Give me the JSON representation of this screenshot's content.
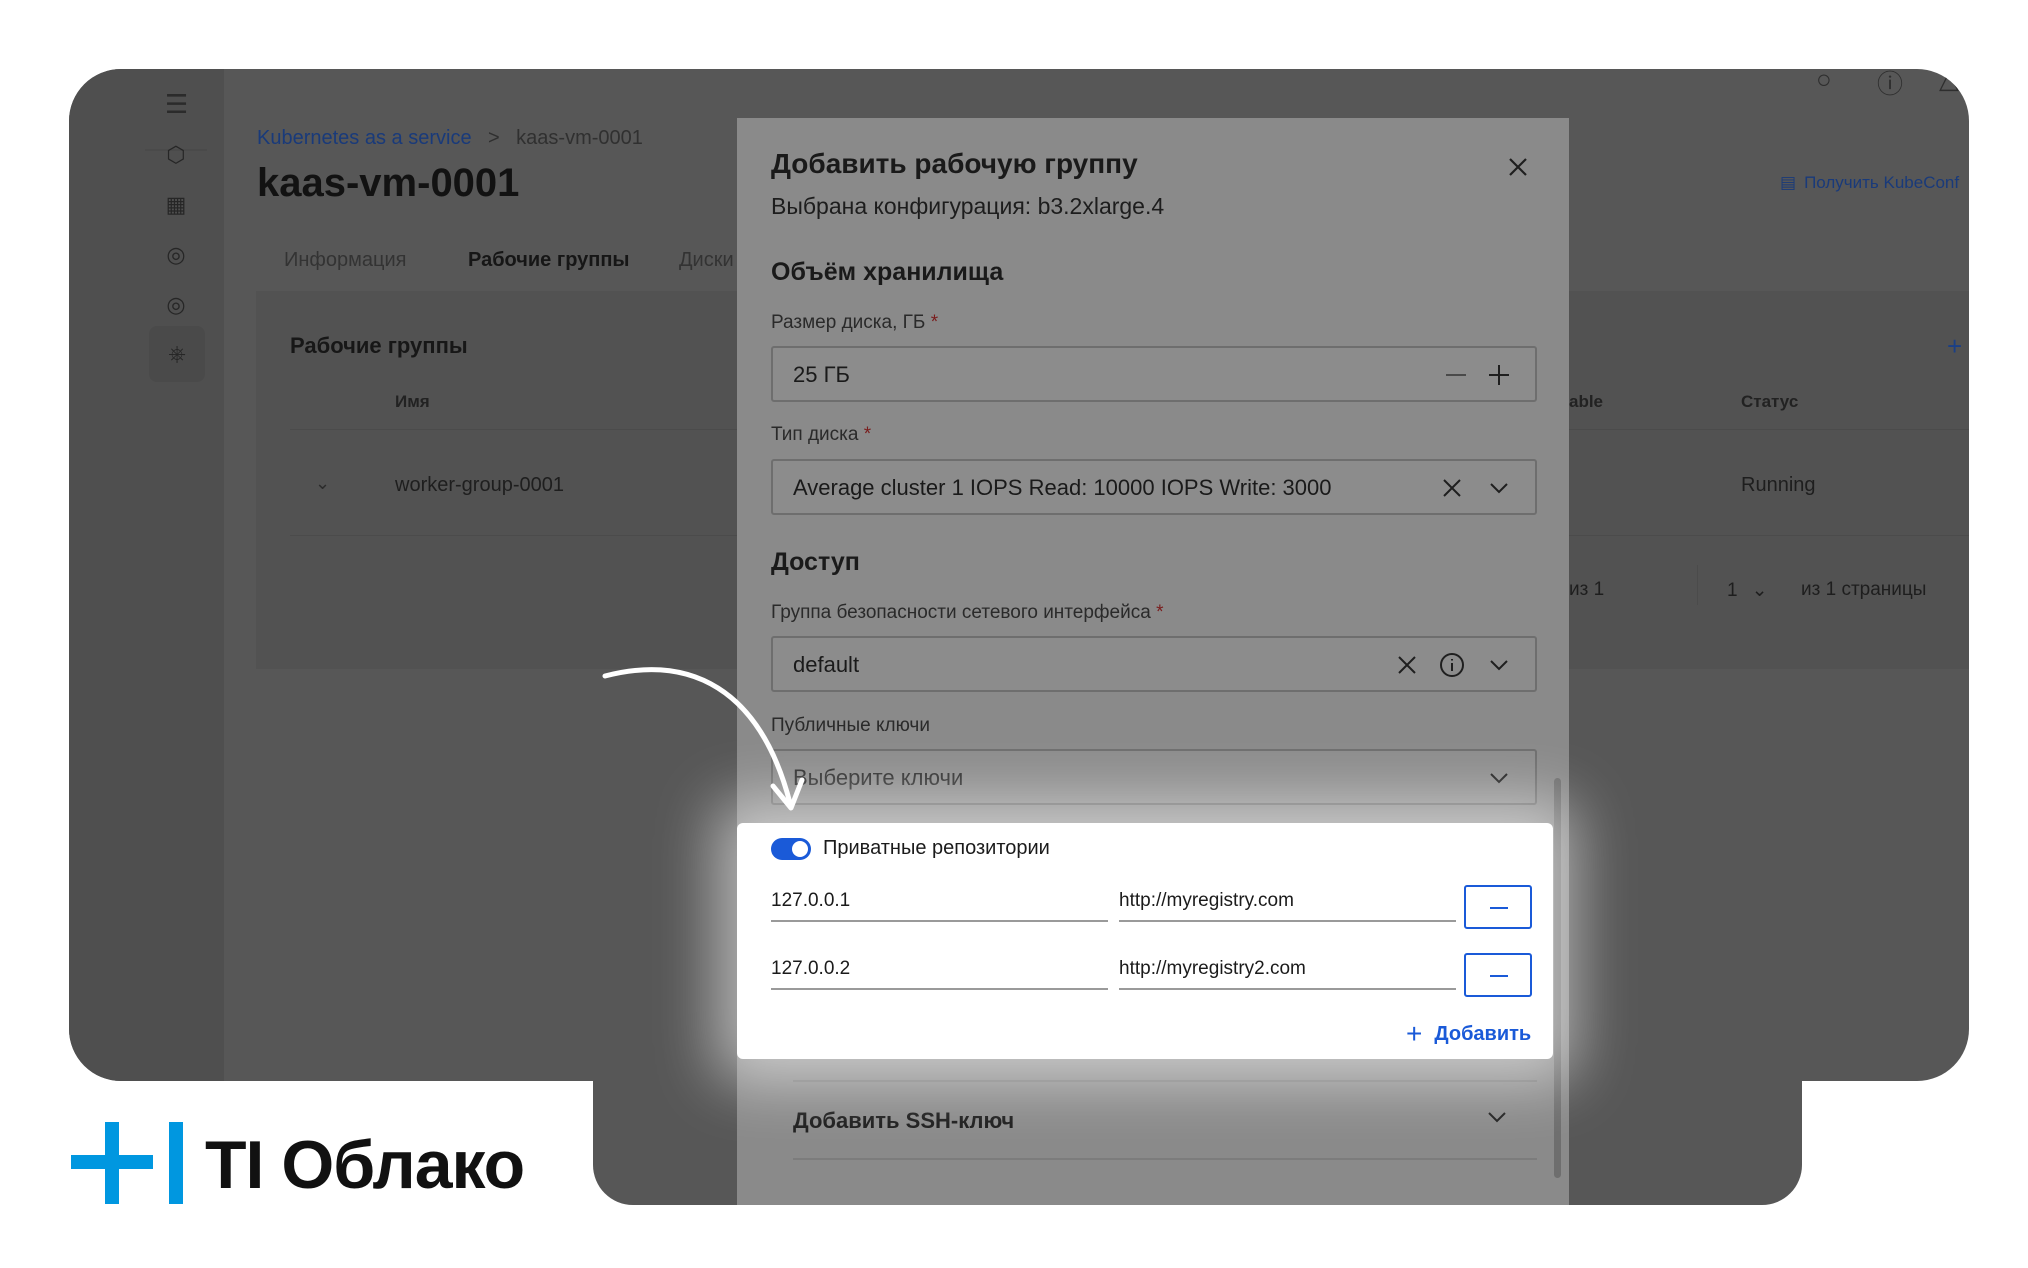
{
  "breadcrumb": {
    "root": "Kubernetes as a service",
    "separator": ">",
    "current": "kaas-vm-0001"
  },
  "page": {
    "title": "kaas-vm-0001",
    "kubeconfig_link": "Получить KubeConf"
  },
  "tabs": [
    {
      "label": "Информация"
    },
    {
      "label": "Рабочие группы"
    },
    {
      "label": "Диски"
    }
  ],
  "workgroups": {
    "section_title": "Рабочие группы",
    "columns": {
      "name": "Имя",
      "scalable": "able",
      "status": "Статус"
    },
    "rows": [
      {
        "name": "worker-group-0001",
        "status": "Running"
      }
    ],
    "pagination": {
      "of_items": "из 1",
      "page": "1",
      "of_pages": "из 1 страницы"
    }
  },
  "modal": {
    "title": "Добавить рабочую группу",
    "subtitle": "Выбрана конфигурация: b3.2xlarge.4",
    "storage_heading": "Объём хранилища",
    "disk_size_label": "Размер диска, ГБ",
    "disk_size_value": "25 ГБ",
    "disk_type_label": "Тип диска",
    "disk_type_value": "Average cluster 1 IOPS Read: 10000 IOPS Write: 3000",
    "access_heading": "Доступ",
    "security_group_label": "Группа безопасности сетевого интерфейса",
    "security_group_value": "default",
    "public_keys_label": "Публичные ключи",
    "public_keys_placeholder": "Выберите ключи",
    "required_mark": "*",
    "private_repos": {
      "toggle_label": "Приватные репозитории",
      "enabled": true,
      "entries": [
        {
          "ip": "127.0.0.1",
          "url": "http://myregistry.com"
        },
        {
          "ip": "127.0.0.2",
          "url": "http://myregistry2.com"
        }
      ],
      "add_label": "Добавить"
    },
    "ssh_key_label": "Добавить SSH-ключ"
  },
  "brand": {
    "name": "TI Облако",
    "accent": "#0097e0"
  },
  "colors": {
    "primary": "#1a5ad8",
    "overlay": "#575757"
  }
}
